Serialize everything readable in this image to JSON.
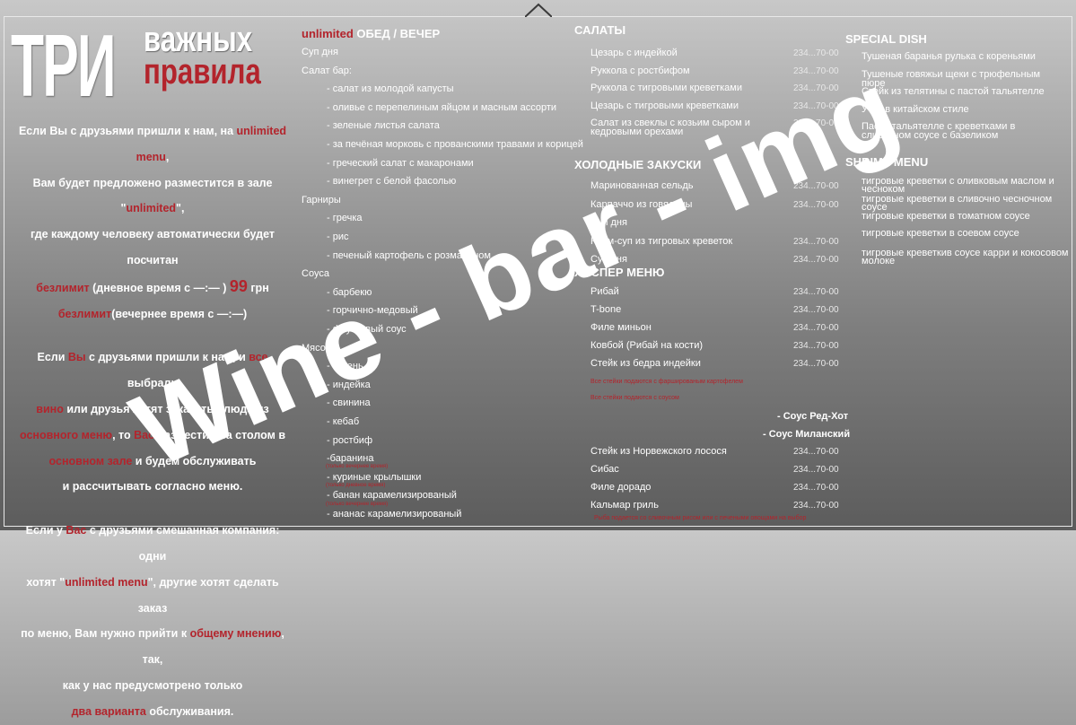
{
  "title": {
    "big": "ТРИ",
    "line1": "важных",
    "line2": "правила"
  },
  "intro": {
    "p1": [
      {
        "parts": [
          {
            "t": "Если Вы с друзьями пришли к нам, на "
          },
          {
            "t": "unlimited menu",
            "r": true
          },
          {
            "t": ","
          }
        ]
      },
      {
        "parts": [
          {
            "t": "Вам будет предложено разместится в зале \""
          },
          {
            "t": "unlimited",
            "r": true
          },
          {
            "t": "\","
          }
        ]
      },
      {
        "parts": [
          {
            "t": "где каждому человеку автоматически будет посчитан"
          }
        ]
      },
      {
        "parts": [
          {
            "t": "безлимит",
            "r": true
          },
          {
            "t": " (дневное время с —:— ) "
          },
          {
            "t": "99",
            "r": true,
            "big": true
          },
          {
            "t": " грн"
          }
        ]
      },
      {
        "parts": [
          {
            "t": "безлимит",
            "r": true
          },
          {
            "t": "(вечернее время с —:—) "
          }
        ]
      }
    ],
    "p2": [
      {
        "parts": [
          {
            "t": "Если "
          },
          {
            "t": "Вы",
            "r": true
          },
          {
            "t": " с друзьями пришли к нам, и "
          },
          {
            "t": "все",
            "r": true
          },
          {
            "t": " выбрали"
          }
        ]
      },
      {
        "parts": [
          {
            "t": "вино",
            "r": true
          },
          {
            "t": " или друзья хотят заказать блюда из"
          }
        ]
      },
      {
        "parts": [
          {
            "t": "основного меню",
            "r": true
          },
          {
            "t": ", то "
          },
          {
            "t": "Вас",
            "r": true
          },
          {
            "t": " разместим за столом в"
          }
        ]
      },
      {
        "parts": [
          {
            "t": "основном зале",
            "r": true
          },
          {
            "t": " и будем обслуживать"
          }
        ]
      },
      {
        "parts": [
          {
            "t": "и рассчитывать согласно меню."
          }
        ]
      }
    ],
    "p3": [
      {
        "parts": [
          {
            "t": "Если у "
          },
          {
            "t": "Вас",
            "r": true
          },
          {
            "t": " с друзьями смешанная компания: одни"
          }
        ]
      },
      {
        "parts": [
          {
            "t": "хотят \""
          },
          {
            "t": "unlimited menu",
            "r": true
          },
          {
            "t": "\", другие хотят сделать заказ"
          }
        ]
      },
      {
        "parts": [
          {
            "t": "по меню, Вам нужно прийти к "
          },
          {
            "t": "общему мнению",
            "r": true
          },
          {
            "t": ", так,"
          }
        ]
      },
      {
        "parts": [
          {
            "t": "как у нас предусмотрено только"
          }
        ]
      },
      {
        "parts": [
          {
            "t": "два варианта",
            "r": true
          },
          {
            "t": " обслуживания."
          }
        ]
      }
    ]
  },
  "col2": {
    "header_red": "unlimited",
    "header": "ОБЕД / ВЕЧЕР",
    "items": [
      {
        "text": "Суп дня",
        "indent": 0
      },
      {
        "text": "Салат бар:",
        "indent": 0
      },
      {
        "text": "- салат из молодой капусты",
        "indent": 1
      },
      {
        "text": "- оливье с перепелиным яйцом и масным ассорти",
        "indent": 1
      },
      {
        "text": "- зеленые листья салата",
        "indent": 1
      },
      {
        "text": "- за печёная морковь с прованскими травами и корицей",
        "indent": 1
      },
      {
        "text": "- греческий салат с макаронами",
        "indent": 1
      },
      {
        "text": "- винегрет с белой фасолью",
        "indent": 1
      },
      {
        "text": "Гарниры",
        "indent": 0
      },
      {
        "text": "- гречка",
        "indent": 1
      },
      {
        "text": "- рис",
        "indent": 1
      },
      {
        "text": "- печеный картофель с розмарином",
        "indent": 1
      },
      {
        "text": "Соуса",
        "indent": 0
      },
      {
        "text": "- барбекю",
        "indent": 1
      },
      {
        "text": "- горчично-медовый",
        "indent": 1
      },
      {
        "text": "- фруктовый соус",
        "indent": 1
      },
      {
        "text": "Мясо",
        "indent": 0
      },
      {
        "text": "- голень",
        "indent": 1
      },
      {
        "text": "- индейка",
        "indent": 1
      },
      {
        "text": "- свинина",
        "indent": 1
      },
      {
        "text": "- кебаб",
        "indent": 1
      },
      {
        "text": "- ростбиф",
        "indent": 1
      },
      {
        "text": "-баранина",
        "indent": 1
      },
      {
        "text": "- куриные крылышки",
        "indent": 1
      },
      {
        "text": "- банан карамелизированый",
        "indent": 1
      },
      {
        "text": "- ананас карамелизированый",
        "indent": 1
      }
    ],
    "small_notes": [
      "(только вечернее время)",
      "(только дневное время)",
      "(только вечернее время)"
    ]
  },
  "col3": {
    "salads_header": "САЛАТЫ",
    "salads": [
      {
        "name": "Цезарь с индейкой",
        "price": "234...70-00"
      },
      {
        "name": "Руккола с ростбифом",
        "price": "234...70-00"
      },
      {
        "name": "Руккола с тигровыми креветками",
        "price": "234...70-00"
      },
      {
        "name": "Цезарь с тигровыми креветками",
        "price": "234...70-00"
      },
      {
        "name": "Салат из свеклы с козьим сыром и кедровыми орехами",
        "price": "234...70-00"
      }
    ],
    "hot_header": "ХОЛОДНЫЕ ЗАКУСКИ",
    "hot": [
      {
        "name": "Маринованная сельдь",
        "price": "234...70-00"
      },
      {
        "name": "Карпаччо из говядины",
        "price": "234...70-00"
      },
      {
        "name": "Суп дня",
        "price": ""
      },
      {
        "name": "Крем-суп из тигровых креветок",
        "price": "234...70-00"
      },
      {
        "name": "Суп дня",
        "price": "234...70-00"
      }
    ],
    "hosper_header": "ХОСПЕР МЕНЮ",
    "hosper": [
      {
        "name": "Рибай",
        "price": "234...70-00"
      },
      {
        "name": "T-bone",
        "price": "234...70-00"
      },
      {
        "name": "Филе миньон",
        "price": "234...70-00"
      },
      {
        "name": "Ковбой (Рибай на кости)",
        "price": "234...70-00"
      },
      {
        "name": "Стейк из бедра индейки",
        "price": "234...70-00"
      }
    ],
    "note1": "Все стейки подаются с фаршированым картофелем",
    "note2": "Все стейки подаются с соусом",
    "sauce1": "- Соус Ред-Хот",
    "sauce2": "- Соус Миланский",
    "fish": [
      {
        "name": "Стейк из Норвежского лосося",
        "price": "234...70-00"
      },
      {
        "name": "Сибас",
        "price": "234...70-00"
      },
      {
        "name": "Филе дорадо",
        "price": "234...70-00"
      },
      {
        "name": "Кальмар гриль",
        "price": "234...70-00"
      }
    ],
    "fish_note": "Рыба подается со сливочным рисом или с печеными овощами на выбор"
  },
  "col4": {
    "special_header": "SPECIAL DISH",
    "special": [
      "Тушеная баранья рулька с кореньями",
      "Тушеные говяжьи щеки с трюфельным пюре",
      "Стейк из телятины с пастой тальятелле",
      "Утка в китайском стиле",
      "Паста тальятелле с креветками в сливочном соусе с базеликом"
    ],
    "shrimp_header": "SHRIMP MENU",
    "shrimp": [
      "тигровые креветки с оливковым маслом и чесноком",
      "тигровые креветки в сливочно чесночном соусе",
      "тигровые креветки в томатном соусе",
      "тигровые креветки в соевом соусе",
      "тигровые креветкив соусе карри и кокосовом молоке"
    ]
  },
  "watermark": "Wine - bar - img"
}
